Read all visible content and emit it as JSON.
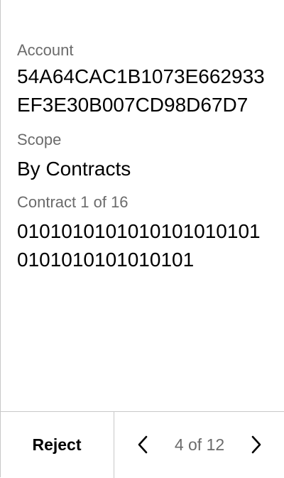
{
  "review": {
    "account_label": "Account",
    "account_value": "54A64CAC1B1073E662933EF3E30B007CD98D67D7",
    "scope_label": "Scope",
    "scope_value": "By Contracts",
    "contract_label": "Contract 1 of 16",
    "contract_value": "01010101010101010101010101010101010101"
  },
  "footer": {
    "reject_label": "Reject",
    "pager_text": "4 of 12",
    "prev_icon": "chevron-left-icon",
    "next_icon": "chevron-right-icon"
  }
}
